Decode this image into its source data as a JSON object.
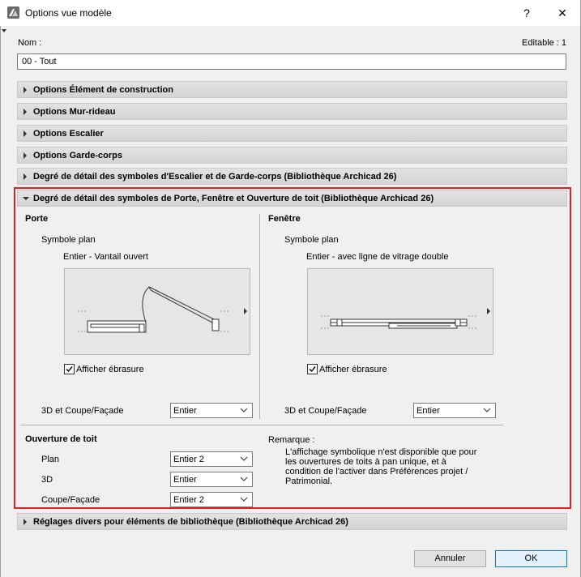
{
  "window": {
    "title": "Options vue modèle",
    "help_label": "?",
    "close_label": "✕"
  },
  "name_label": "Nom :",
  "editable_label": "Editable : 1",
  "name_value": "00 - Tout",
  "sections": [
    "Options Élément de construction",
    "Options Mur-rideau",
    "Options Escalier",
    "Options Garde-corps",
    "Degré de détail des symboles d'Escalier et de Garde-corps (Bibliothèque Archicad 26)"
  ],
  "expanded_section": "Degré de détail des symboles de Porte, Fenêtre et Ouverture de toit (Bibliothèque Archicad 26)",
  "door": {
    "heading": "Porte",
    "plan_symbol_label": "Symbole plan",
    "option_name": "Entier - Vantail ouvert",
    "show_reveal_label": "Afficher ébrasure",
    "show_reveal_checked": true,
    "view3d_label": "3D et Coupe/Façade",
    "view3d_value": "Entier"
  },
  "window_opt": {
    "heading": "Fenêtre",
    "plan_symbol_label": "Symbole plan",
    "option_name": "Entier - avec ligne de vitrage double",
    "show_reveal_label": "Afficher ébrasure",
    "show_reveal_checked": true,
    "view3d_label": "3D et Coupe/Façade",
    "view3d_value": "Entier"
  },
  "roof": {
    "heading": "Ouverture de toit",
    "plan_label": "Plan",
    "plan_value": "Entier 2",
    "d3_label": "3D",
    "d3_value": "Entier",
    "section_label": "Coupe/Façade",
    "section_value": "Entier 2"
  },
  "remark": {
    "heading": "Remarque :",
    "text": "L'affichage symbolique n'est disponible que pour\nles ouvertures de toits à pan unique, et à\ncondition de l'activer dans Préférences projet /\nPatrimonial."
  },
  "bottom_section": "Réglages divers pour éléments de bibliothèque (Bibliothèque Archicad 26)",
  "buttons": {
    "cancel": "Annuler",
    "ok": "OK"
  }
}
